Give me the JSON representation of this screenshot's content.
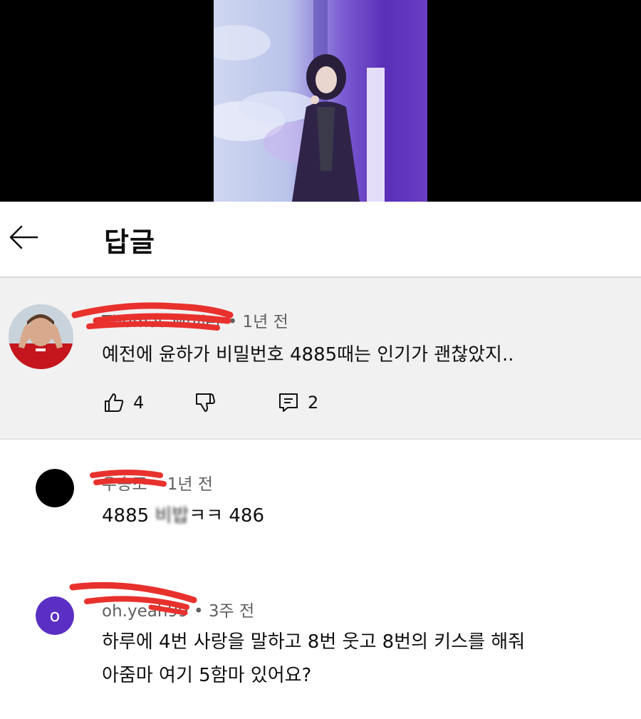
{
  "header": {
    "title": "답글"
  },
  "parent_comment": {
    "author": "Thomas Müller",
    "time": "1년 전",
    "text": "예전에 윤하가 비밀번호 4885때는 인기가 괜찮았지..",
    "like_count": "4",
    "reply_count": "2"
  },
  "replies": [
    {
      "author": "우승조",
      "time": "1년 전",
      "text_before": "4885 ",
      "text_blurred": "비밥",
      "text_after": "ㅋㅋ 486",
      "avatar_color": "#000000"
    },
    {
      "author": "oh.yeah99",
      "time": "3주 전",
      "avatar_letter": "o",
      "avatar_color": "#5b2fc4",
      "text_line1": "하루에 4번 사랑을 말하고 8번 웃고 8번의 키스를 해줘",
      "text_line2": "아줌마 여기 5함마 있어요?"
    }
  ],
  "colors": {
    "parent_bg": "#f1f1f1",
    "redaction": "#e8312d",
    "meta_text": "#606060"
  }
}
